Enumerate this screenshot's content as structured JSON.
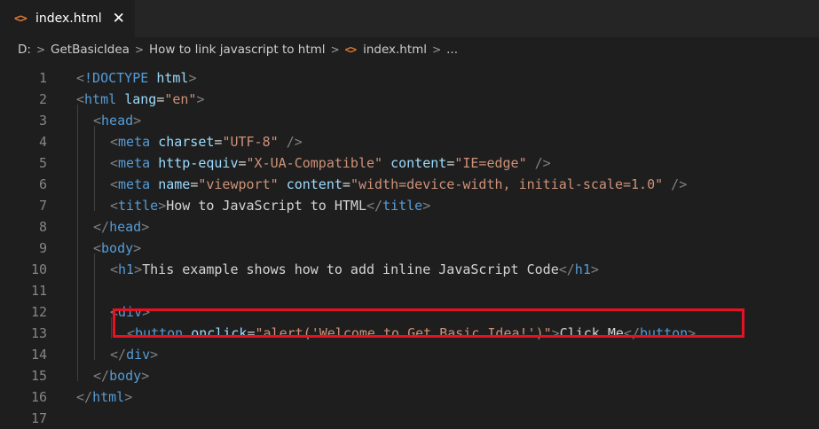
{
  "tab": {
    "icon": "html-file-icon",
    "label": "index.html",
    "close": "✕"
  },
  "breadcrumb": {
    "items": [
      "D:",
      "GetBasicIdea",
      "How to link javascript to html",
      "index.html",
      "..."
    ],
    "separator": ">"
  },
  "colors": {
    "background": "#1e1e1e",
    "tag": "#569cd6",
    "attribute": "#9cdcfe",
    "string": "#ce9178",
    "text": "#d4d4d4",
    "punctuation": "#808080",
    "line_number": "#858585",
    "highlight_box": "#e81123",
    "file_icon": "#e37933"
  },
  "code_lines": [
    {
      "n": "1",
      "tokens": [
        [
          "punc",
          "<"
        ],
        [
          "tag",
          "!DOCTYPE"
        ],
        [
          "txt",
          " "
        ],
        [
          "attr",
          "html"
        ],
        [
          "punc",
          ">"
        ]
      ]
    },
    {
      "n": "2",
      "tokens": [
        [
          "punc",
          "<"
        ],
        [
          "tag",
          "html"
        ],
        [
          "txt",
          " "
        ],
        [
          "attr",
          "lang"
        ],
        [
          "txt",
          "="
        ],
        [
          "str",
          "\"en\""
        ],
        [
          "punc",
          ">"
        ]
      ]
    },
    {
      "n": "3",
      "tokens": [
        [
          "punc",
          "<"
        ],
        [
          "tag",
          "head"
        ],
        [
          "punc",
          ">"
        ]
      ]
    },
    {
      "n": "4",
      "tokens": [
        [
          "punc",
          "<"
        ],
        [
          "tag",
          "meta"
        ],
        [
          "txt",
          " "
        ],
        [
          "attr",
          "charset"
        ],
        [
          "txt",
          "="
        ],
        [
          "str",
          "\"UTF-8\""
        ],
        [
          "txt",
          " "
        ],
        [
          "punc",
          "/>"
        ]
      ]
    },
    {
      "n": "5",
      "tokens": [
        [
          "punc",
          "<"
        ],
        [
          "tag",
          "meta"
        ],
        [
          "txt",
          " "
        ],
        [
          "attr",
          "http-equiv"
        ],
        [
          "txt",
          "="
        ],
        [
          "str",
          "\"X-UA-Compatible\""
        ],
        [
          "txt",
          " "
        ],
        [
          "attr",
          "content"
        ],
        [
          "txt",
          "="
        ],
        [
          "str",
          "\"IE=edge\""
        ],
        [
          "txt",
          " "
        ],
        [
          "punc",
          "/>"
        ]
      ]
    },
    {
      "n": "6",
      "tokens": [
        [
          "punc",
          "<"
        ],
        [
          "tag",
          "meta"
        ],
        [
          "txt",
          " "
        ],
        [
          "attr",
          "name"
        ],
        [
          "txt",
          "="
        ],
        [
          "str",
          "\"viewport\""
        ],
        [
          "txt",
          " "
        ],
        [
          "attr",
          "content"
        ],
        [
          "txt",
          "="
        ],
        [
          "str",
          "\"width=device-width, initial-scale=1.0\""
        ],
        [
          "txt",
          " "
        ],
        [
          "punc",
          "/>"
        ]
      ]
    },
    {
      "n": "7",
      "tokens": [
        [
          "punc",
          "<"
        ],
        [
          "tag",
          "title"
        ],
        [
          "punc",
          ">"
        ],
        [
          "txt",
          "How to JavaScript to HTML"
        ],
        [
          "punc",
          "</"
        ],
        [
          "tag",
          "title"
        ],
        [
          "punc",
          ">"
        ]
      ]
    },
    {
      "n": "8",
      "tokens": [
        [
          "punc",
          "</"
        ],
        [
          "tag",
          "head"
        ],
        [
          "punc",
          ">"
        ]
      ]
    },
    {
      "n": "9",
      "tokens": [
        [
          "punc",
          "<"
        ],
        [
          "tag",
          "body"
        ],
        [
          "punc",
          ">"
        ]
      ]
    },
    {
      "n": "10",
      "tokens": [
        [
          "punc",
          "<"
        ],
        [
          "tag",
          "h1"
        ],
        [
          "punc",
          ">"
        ],
        [
          "txt",
          "This example shows how to add inline JavaScript Code"
        ],
        [
          "punc",
          "</"
        ],
        [
          "tag",
          "h1"
        ],
        [
          "punc",
          ">"
        ]
      ]
    },
    {
      "n": "11",
      "tokens": []
    },
    {
      "n": "12",
      "tokens": [
        [
          "punc",
          "<"
        ],
        [
          "tag",
          "div"
        ],
        [
          "punc",
          ">"
        ]
      ]
    },
    {
      "n": "13",
      "tokens": [
        [
          "punc",
          "<"
        ],
        [
          "tag",
          "button"
        ],
        [
          "txt",
          " "
        ],
        [
          "attr",
          "onclick"
        ],
        [
          "txt",
          "="
        ],
        [
          "str",
          "\"alert('Welcome to Get Basic Idea!')\""
        ],
        [
          "punc",
          ">"
        ],
        [
          "txt",
          "Click Me"
        ],
        [
          "punc",
          "</"
        ],
        [
          "tag",
          "button"
        ],
        [
          "punc",
          ">"
        ]
      ]
    },
    {
      "n": "14",
      "tokens": [
        [
          "punc",
          "</"
        ],
        [
          "tag",
          "div"
        ],
        [
          "punc",
          ">"
        ]
      ]
    },
    {
      "n": "15",
      "tokens": [
        [
          "punc",
          "</"
        ],
        [
          "tag",
          "body"
        ],
        [
          "punc",
          ">"
        ]
      ]
    },
    {
      "n": "16",
      "tokens": [
        [
          "punc",
          "</"
        ],
        [
          "tag",
          "html"
        ],
        [
          "punc",
          ">"
        ]
      ]
    },
    {
      "n": "17",
      "tokens": []
    }
  ]
}
